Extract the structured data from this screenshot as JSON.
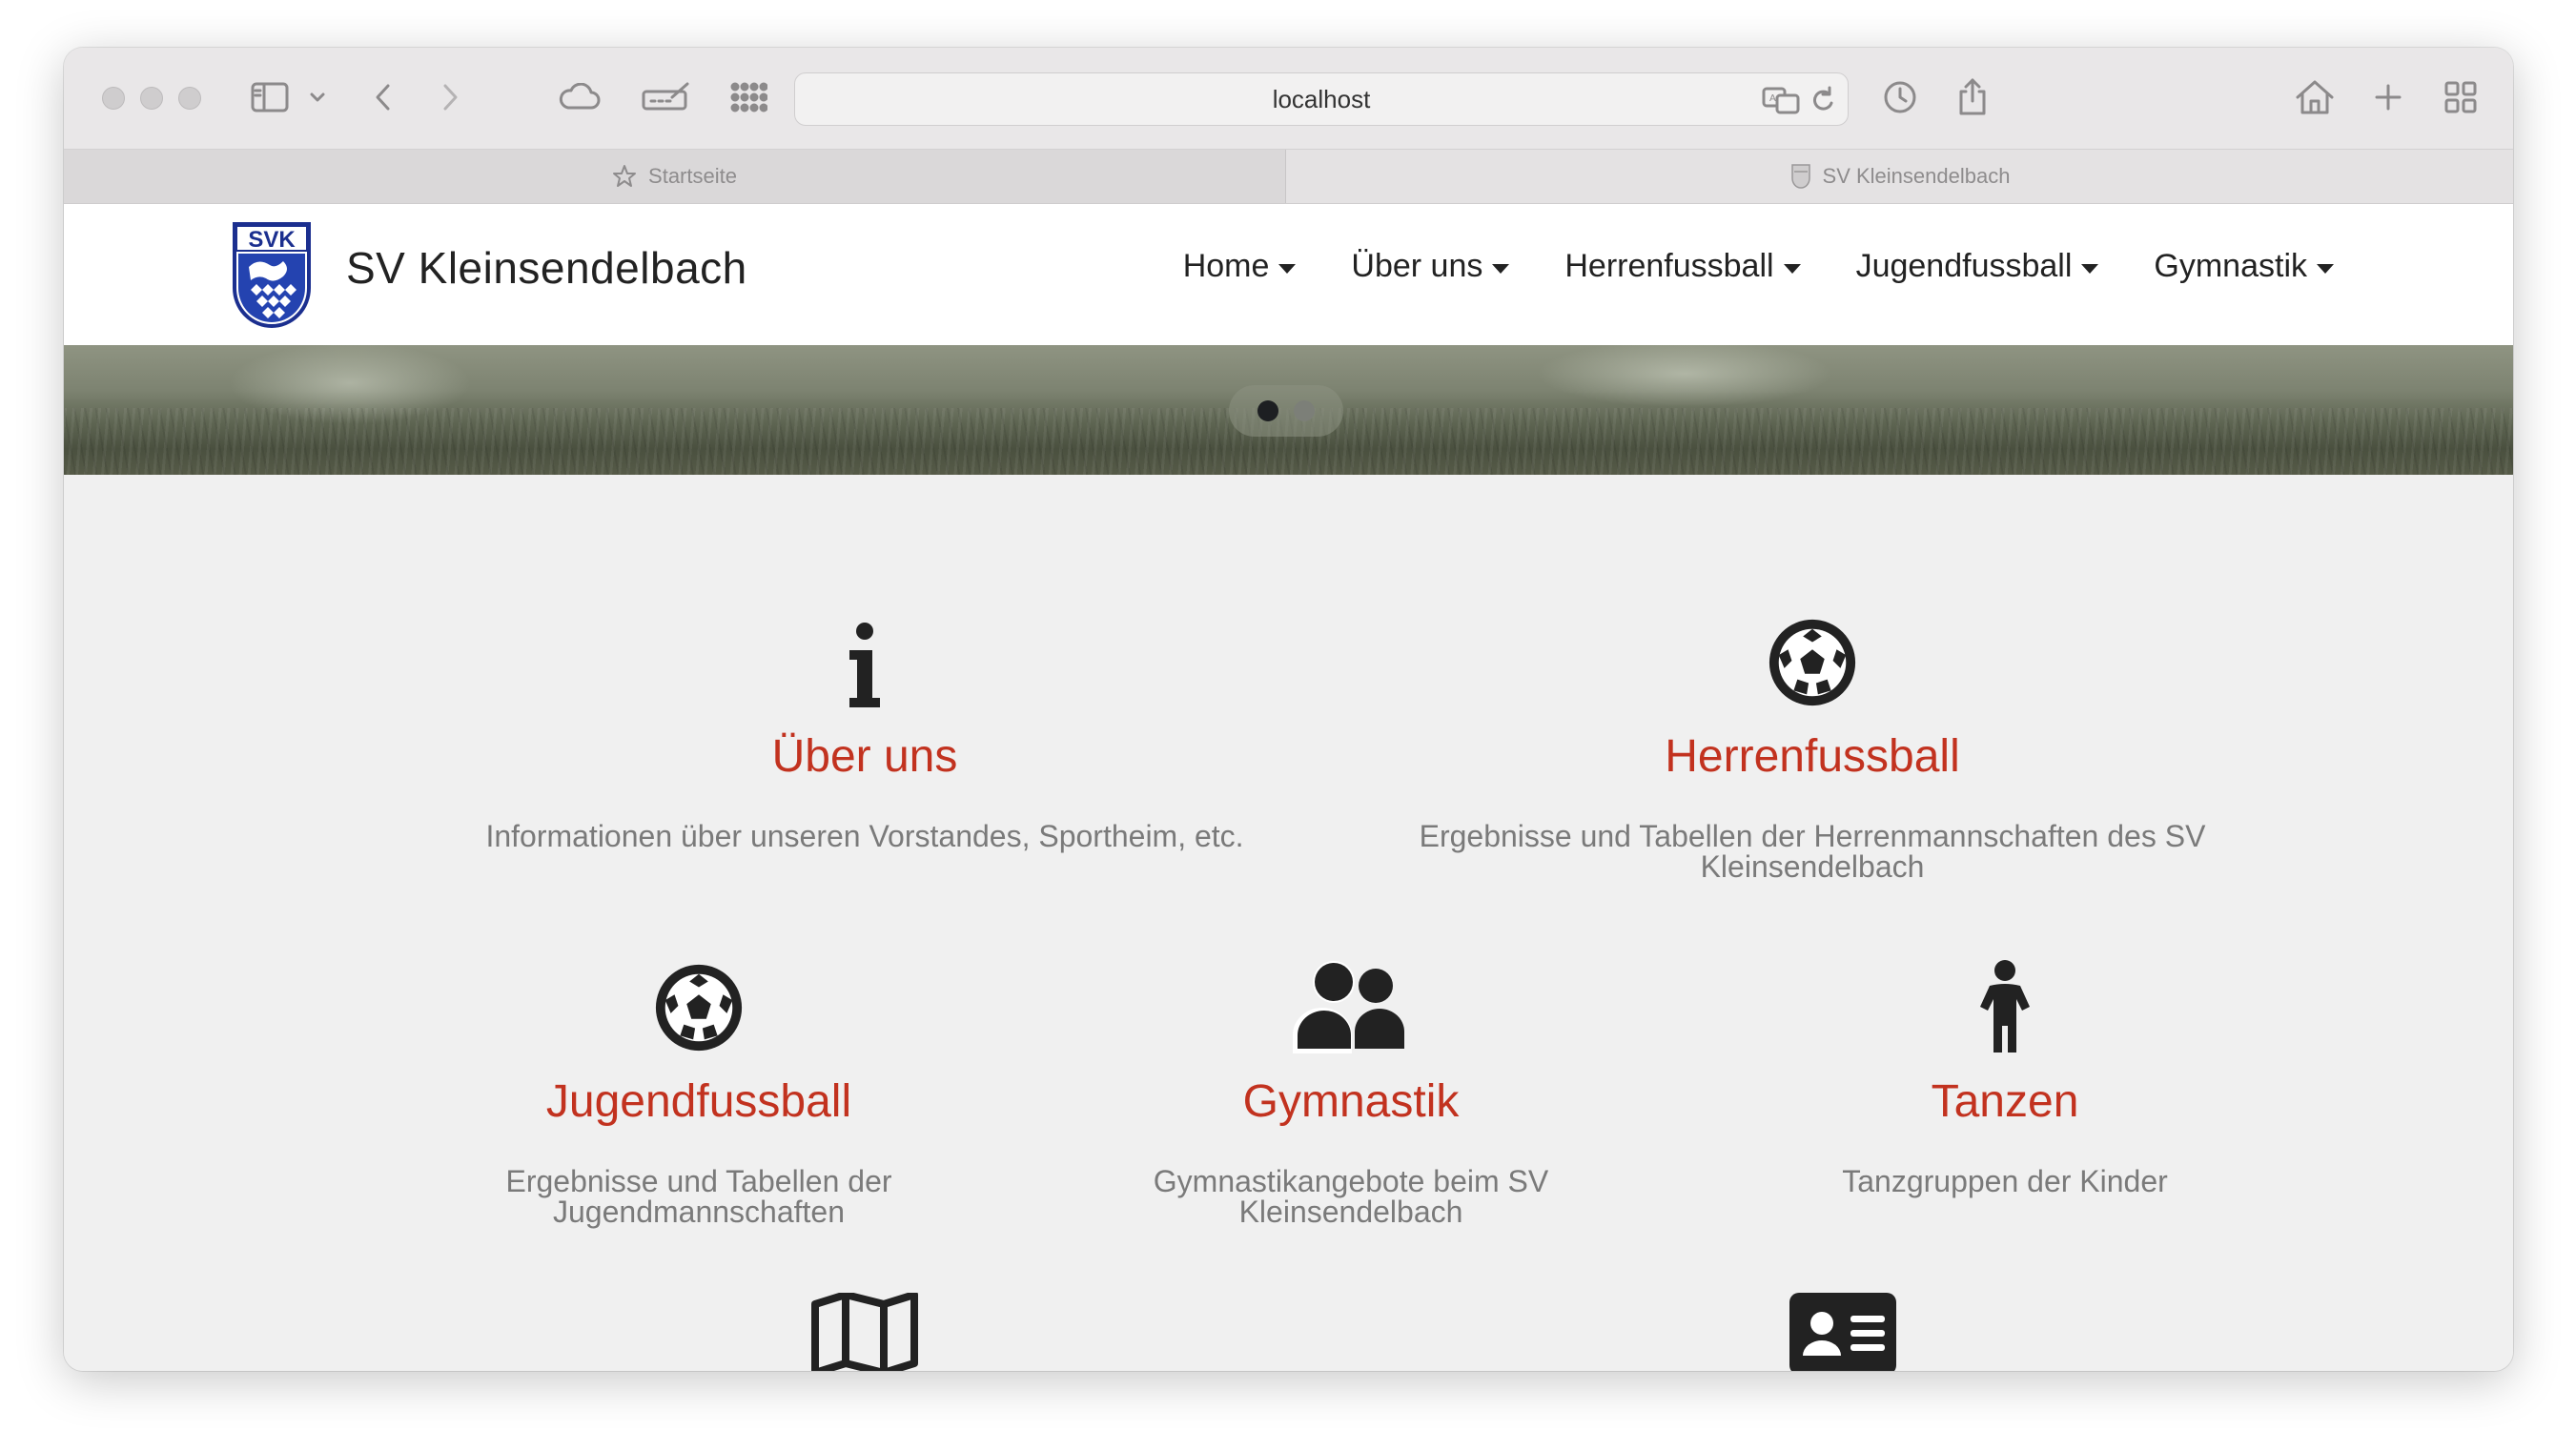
{
  "browser": {
    "url": "localhost",
    "tabs": [
      {
        "label": "Startseite",
        "active": true
      },
      {
        "label": "SV Kleinsendelbach",
        "active": false
      }
    ]
  },
  "site": {
    "brand": "SV Kleinsendelbach",
    "logo_text": "SVK",
    "menu": [
      "Home",
      "Über uns",
      "Herrenfussball",
      "Jugendfussball",
      "Gymnastik"
    ]
  },
  "carousel": {
    "slides": 2,
    "active_index": 0
  },
  "features": [
    {
      "icon": "info-icon",
      "title": "Über uns",
      "desc": "Informationen über unseren Vorstandes, Sportheim, etc."
    },
    {
      "icon": "soccer-ball-icon",
      "title": "Herrenfussball",
      "desc": "Ergebnisse und Tabellen der Herrenmannschaften des SV Kleinsendelbach"
    },
    {
      "icon": "soccer-ball-icon",
      "title": "Jugendfussball",
      "desc": "Ergebnisse und Tabellen der Jugendmannschaften"
    },
    {
      "icon": "users-icon",
      "title": "Gymnastik",
      "desc": "Gymnastikangebote beim SV Kleinsendelbach"
    },
    {
      "icon": "child-icon",
      "title": "Tanzen",
      "desc": "Tanzgruppen der Kinder"
    },
    {
      "icon": "map-icon",
      "title": "",
      "desc": ""
    },
    {
      "icon": "id-card-icon",
      "title": "",
      "desc": ""
    }
  ],
  "colors": {
    "accent": "#c2321f",
    "icon": "#222222",
    "text_muted": "#7a7a7a"
  }
}
